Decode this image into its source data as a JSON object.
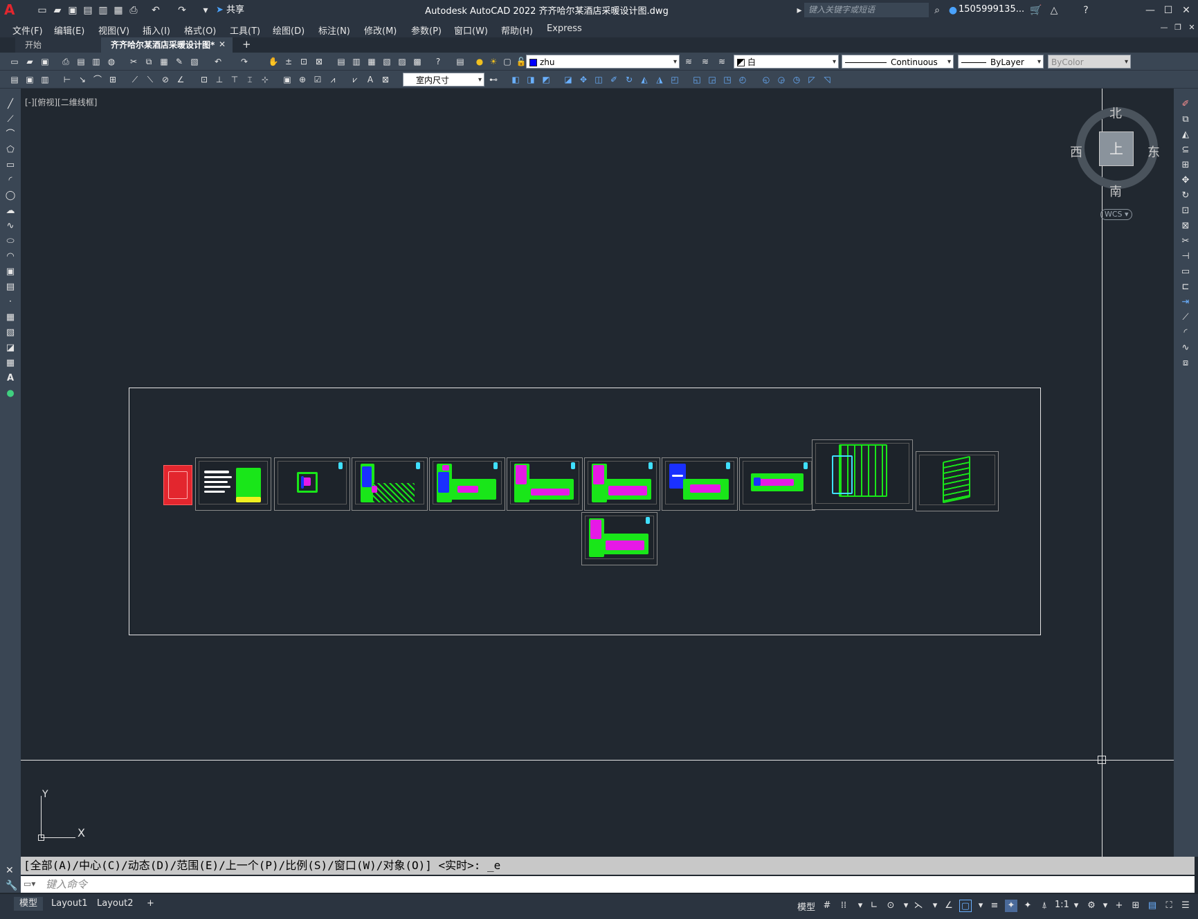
{
  "titlebar": {
    "app_logo": "A",
    "window_title": "Autodesk AutoCAD 2022    齐齐哈尔某酒店采暖设计图.dwg",
    "share_label": "共享",
    "search_placeholder": "键入关键字或短语",
    "user_name": "1505999135...",
    "controls": {
      "minimize": "—",
      "maximize": "☐",
      "close": "✕"
    }
  },
  "menubar": {
    "items": [
      "文件(F)",
      "编辑(E)",
      "视图(V)",
      "插入(I)",
      "格式(O)",
      "工具(T)",
      "绘图(D)",
      "标注(N)",
      "修改(M)",
      "参数(P)",
      "窗口(W)",
      "帮助(H)",
      "Express"
    ]
  },
  "tabs": {
    "start": "开始",
    "drawing": "齐齐哈尔某酒店采暖设计图*",
    "close": "✕",
    "add": "+"
  },
  "toolbar1": {
    "layer": {
      "name": "zhu",
      "color": "#0000ff"
    },
    "color_combo": "白",
    "linetype_combo": "Continuous",
    "lineweight_combo": "ByLayer",
    "plotstyle_combo": "ByColor"
  },
  "toolbar2": {
    "dimstyle_combo": "室内尺寸"
  },
  "viewport": {
    "label": "[-][俯视][二维线框]"
  },
  "viewcube": {
    "north": "北",
    "south": "南",
    "east": "东",
    "west": "西",
    "top_face": "上",
    "wcs": "WCS"
  },
  "ucs": {
    "x": "X",
    "y": "Y"
  },
  "command": {
    "history": "[全部(A)/中心(C)/动态(D)/范围(E)/上一个(P)/比例(S)/窗口(W)/对象(O)] <实时>: _e",
    "input_placeholder": "键入命令"
  },
  "statusbar": {
    "tabs": [
      "模型",
      "Layout1",
      "Layout2"
    ],
    "add": "+",
    "model_label": "模型",
    "scale": "1:1"
  },
  "colors": {
    "background": "#212830",
    "panel": "#3a4654",
    "accent_red": "#e3262e",
    "drawing_green": "#19e619",
    "drawing_magenta": "#e619e6"
  }
}
